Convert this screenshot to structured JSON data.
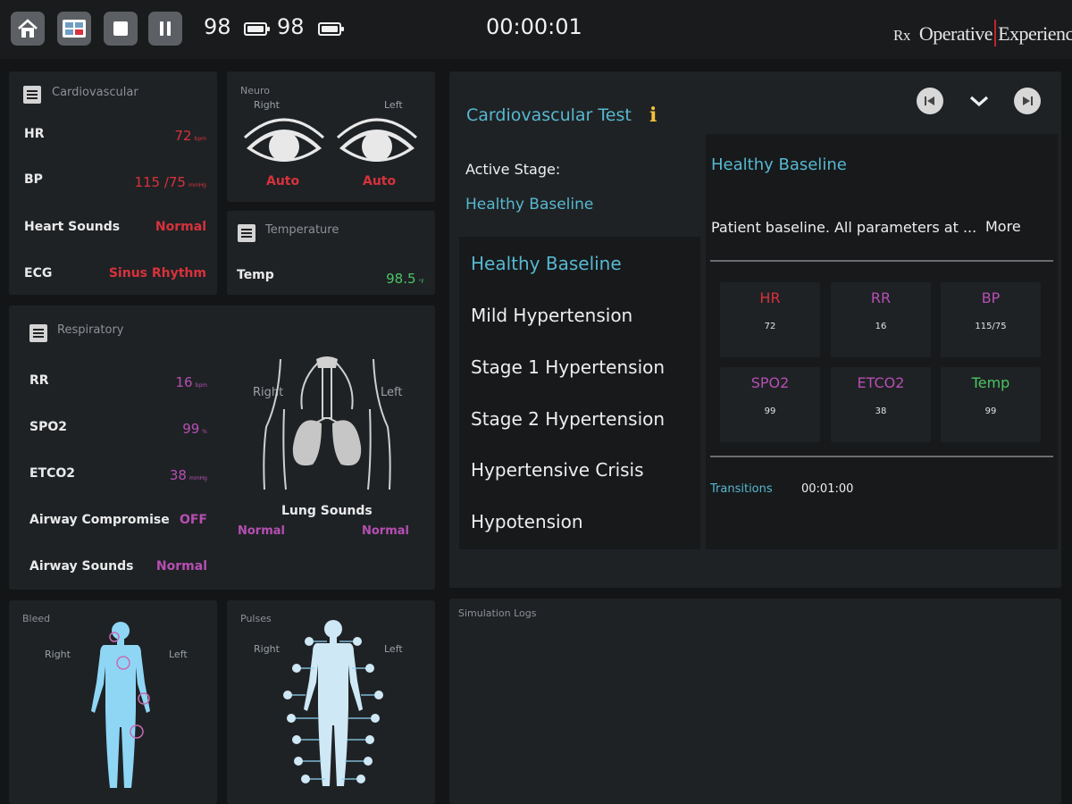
{
  "toolbar": {
    "buttons": [
      "home-icon",
      "layout-icon",
      "stop-icon",
      "pause-icon"
    ],
    "battery_1": "98",
    "battery_2": "98",
    "timer": "00:00:01",
    "brand": {
      "rx": "Rx",
      "left": "Operative",
      "right": "Experience"
    }
  },
  "cardio": {
    "title": "Cardiovascular",
    "rows": [
      {
        "label": "HR",
        "value": "72",
        "unit": "bpm"
      },
      {
        "label": "BP",
        "value": "115 /75",
        "unit": "mmHg"
      },
      {
        "label": "Heart Sounds",
        "value": "Normal",
        "unit": ""
      },
      {
        "label": "ECG",
        "value": "Sinus Rhythm",
        "unit": ""
      }
    ]
  },
  "neuro": {
    "title": "Neuro",
    "right": "Right",
    "left": "Left",
    "right_value": "Auto",
    "left_value": "Auto"
  },
  "temperature": {
    "title": "Temperature",
    "label": "Temp",
    "value": "98.5",
    "unit": "°F"
  },
  "respiratory": {
    "title": "Respiratory",
    "rows": [
      {
        "label": "RR",
        "value": "16",
        "unit": "bpm"
      },
      {
        "label": "SPO2",
        "value": "99",
        "unit": "%"
      },
      {
        "label": "ETCO2",
        "value": "38",
        "unit": "mmHg"
      },
      {
        "label": "Airway Compromise",
        "value": "OFF",
        "unit": ""
      },
      {
        "label": "Airway Sounds",
        "value": "Normal",
        "unit": ""
      }
    ],
    "lungs": {
      "right": "Right",
      "left": "Left",
      "title": "Lung Sounds",
      "right_value": "Normal",
      "left_value": "Normal"
    }
  },
  "bleed": {
    "title": "Bleed",
    "right": "Right",
    "left": "Left"
  },
  "pulses": {
    "title": "Pulses",
    "right": "Right",
    "left": "Left"
  },
  "scenario": {
    "title": "Cardiovascular Test",
    "info": "i",
    "active_label": "Active Stage:",
    "active_value": "Healthy Baseline",
    "stages": [
      "Healthy Baseline",
      "Mild Hypertension",
      "Stage 1 Hypertension",
      "Stage 2 Hypertension",
      "Hypertensive Crisis",
      "Hypotension"
    ],
    "detail": {
      "title": "Healthy Baseline",
      "description": "Patient baseline. All parameters at ...",
      "more": "More",
      "vitals": [
        {
          "name": "HR",
          "value": "72",
          "color": "#d7323c"
        },
        {
          "name": "RR",
          "value": "16",
          "color": "#b64fb2"
        },
        {
          "name": "BP",
          "value": "115/75",
          "color": "#b64fb2"
        },
        {
          "name": "SPO2",
          "value": "99",
          "color": "#b64fb2"
        },
        {
          "name": "ETCO2",
          "value": "38",
          "color": "#b64fb2"
        },
        {
          "name": "Temp",
          "value": "99",
          "color": "#4bc463"
        }
      ],
      "transitions_label": "Transitions",
      "transitions_value": "00:01:00"
    }
  },
  "logs": {
    "title": "Simulation Logs"
  }
}
